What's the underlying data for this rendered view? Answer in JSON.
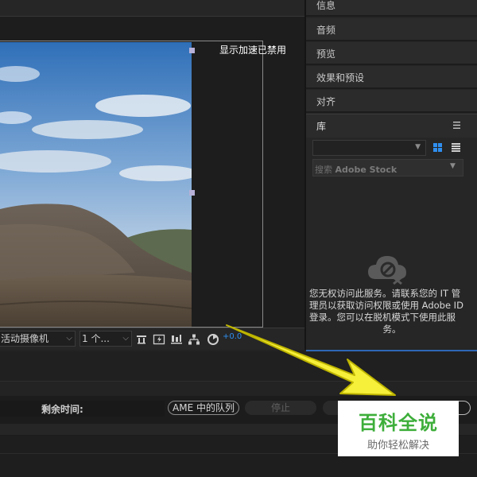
{
  "viewer": {
    "accel_label": "显示加速已禁用",
    "camera_select": "活动摄像机",
    "views_select": "1 个...",
    "exposure_value": "+0.0"
  },
  "right_panel": {
    "items": [
      {
        "label": "信息"
      },
      {
        "label": "音频"
      },
      {
        "label": "预览"
      },
      {
        "label": "效果和预设"
      },
      {
        "label": "对齐"
      }
    ],
    "library": {
      "title": "库",
      "search_prefix": "搜索",
      "search_service": "Adobe Stock",
      "message_lines": [
        "您无权访问此服务。请联系您的 IT 管",
        "理员以获取访问权限或使用 Adobe ID",
        "登录。您可以在脱机模式下使用此服",
        "务。"
      ]
    }
  },
  "render_queue": {
    "remaining_label": "剩余时间:",
    "ame_queue_button": "AME 中的队列",
    "stop_button": "停止"
  },
  "watermark": {
    "title": "百科全说",
    "subtitle": "助你轻松解决"
  },
  "colors": {
    "accent_blue": "#2f8ff0",
    "arrow_yellow": "#f7f03a",
    "watermark_green": "#3dae3a"
  }
}
